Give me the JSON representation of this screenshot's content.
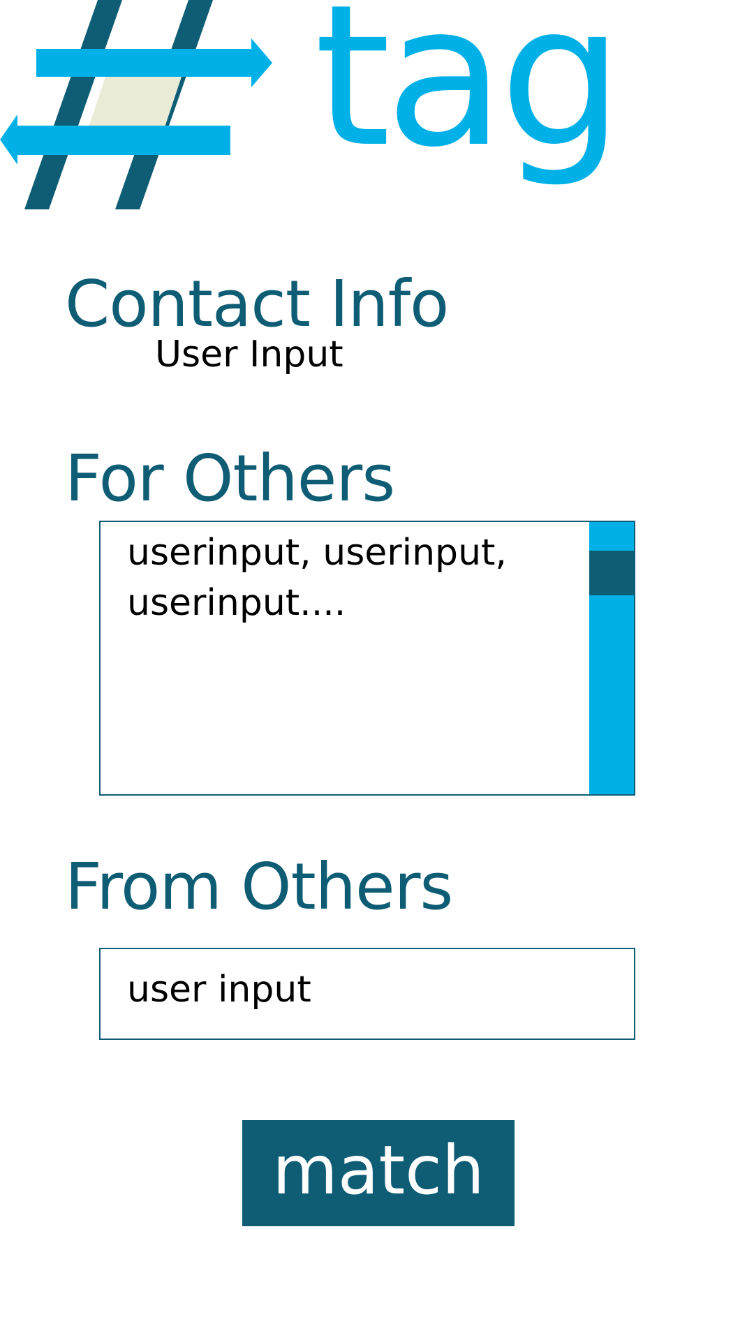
{
  "logo": {
    "text": "tag",
    "icon": "hashtag-arrows-icon",
    "colors": {
      "primary": "#00B0E6",
      "dark": "#0E5D75",
      "fill": "#E9EBD6"
    }
  },
  "contact": {
    "title": "Contact Info",
    "value": "User Input"
  },
  "for_others": {
    "title": "For Others",
    "value": "userinput, userinput, userinput....",
    "scrollbar": {
      "track_color": "#00B0E6",
      "thumb_color": "#0E5D75"
    }
  },
  "from_others": {
    "title": "From Others",
    "value": "user input"
  },
  "actions": {
    "match_label": "match",
    "button_color": "#0E5D75"
  }
}
